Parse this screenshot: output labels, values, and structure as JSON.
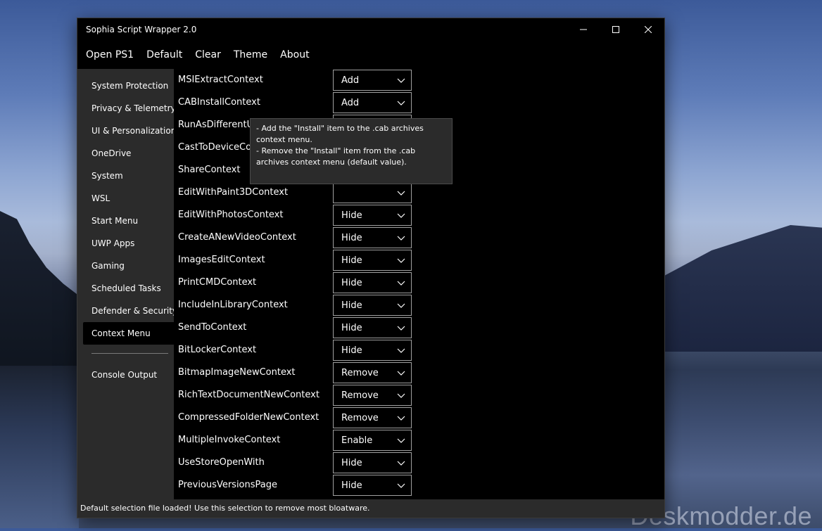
{
  "window": {
    "title": "Sophia Script Wrapper 2.0",
    "controls": {
      "minimize": "—",
      "maximize": "☐",
      "close": "✕"
    }
  },
  "menu": [
    "Open PS1",
    "Default",
    "Clear",
    "Theme",
    "About"
  ],
  "sidebar": {
    "items": [
      "System Protection",
      "Privacy & Telemetry",
      "UI & Personalization",
      "OneDrive",
      "System",
      "WSL",
      "Start Menu",
      "UWP Apps",
      "Gaming",
      "Scheduled Tasks",
      "Defender & Security",
      "Context Menu"
    ],
    "active_index": 11,
    "console": "Console Output"
  },
  "rows": [
    {
      "label": "MSIExtractContext",
      "value": "Add"
    },
    {
      "label": "CABInstallContext",
      "value": "Add"
    },
    {
      "label": "RunAsDifferentU",
      "value": ""
    },
    {
      "label": "CastToDeviceCor",
      "value": ""
    },
    {
      "label": "ShareContext",
      "value": ""
    },
    {
      "label": "EditWithPaint3DContext",
      "value": ""
    },
    {
      "label": "EditWithPhotosContext",
      "value": "Hide"
    },
    {
      "label": "CreateANewVideoContext",
      "value": "Hide"
    },
    {
      "label": "ImagesEditContext",
      "value": "Hide"
    },
    {
      "label": "PrintCMDContext",
      "value": "Hide"
    },
    {
      "label": "IncludeInLibraryContext",
      "value": "Hide"
    },
    {
      "label": "SendToContext",
      "value": "Hide"
    },
    {
      "label": "BitLockerContext",
      "value": "Hide"
    },
    {
      "label": "BitmapImageNewContext",
      "value": "Remove"
    },
    {
      "label": "RichTextDocumentNewContext",
      "value": "Remove"
    },
    {
      "label": "CompressedFolderNewContext",
      "value": "Remove"
    },
    {
      "label": "MultipleInvokeContext",
      "value": "Enable"
    },
    {
      "label": "UseStoreOpenWith",
      "value": "Hide"
    },
    {
      "label": "PreviousVersionsPage",
      "value": "Hide"
    }
  ],
  "tooltip": {
    "line1": "- Add the \"Install\" item to the .cab archives context menu.",
    "line2": "- Remove the \"Install\" item from the .cab archives context menu (default value)."
  },
  "status": "Default selection file loaded! Use this selection to remove most bloatware.",
  "watermark": "Deskmodder.de",
  "colors": {
    "window_bg": "#000000",
    "sidebar_bg": "#2b2b2b",
    "combo_border": "#a0a0a0",
    "text": "#ffffff"
  }
}
